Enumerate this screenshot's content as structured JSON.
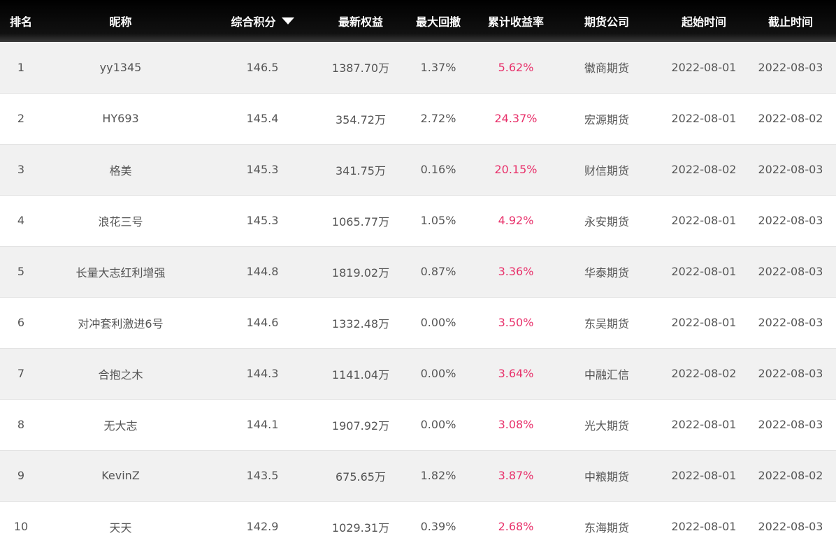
{
  "colors": {
    "header_bg": "#000000",
    "header_text": "#ffffff",
    "row_alt": "#f1f1f1",
    "text": "#555555",
    "positive_rate": "#e8306a"
  },
  "headers": {
    "rank": "排名",
    "nickname": "昵称",
    "score": "综合积分",
    "equity": "最新权益",
    "drawdown": "最大回撤",
    "return_rate": "累计收益率",
    "broker": "期货公司",
    "start": "起始时间",
    "end": "截止时间"
  },
  "sort": {
    "column": "score",
    "direction": "descending",
    "icon": "sort-down-icon"
  },
  "rows": [
    {
      "rank": "1",
      "nickname": "yy1345",
      "score": "146.5",
      "equity": "1387.70万",
      "drawdown": "1.37%",
      "return_rate": "5.62%",
      "broker": "徽商期货",
      "start": "2022-08-01",
      "end": "2022-08-03"
    },
    {
      "rank": "2",
      "nickname": "HY693",
      "score": "145.4",
      "equity": "354.72万",
      "drawdown": "2.72%",
      "return_rate": "24.37%",
      "broker": "宏源期货",
      "start": "2022-08-01",
      "end": "2022-08-02"
    },
    {
      "rank": "3",
      "nickname": "格美",
      "score": "145.3",
      "equity": "341.75万",
      "drawdown": "0.16%",
      "return_rate": "20.15%",
      "broker": "财信期货",
      "start": "2022-08-02",
      "end": "2022-08-03"
    },
    {
      "rank": "4",
      "nickname": "浪花三号",
      "score": "145.3",
      "equity": "1065.77万",
      "drawdown": "1.05%",
      "return_rate": "4.92%",
      "broker": "永安期货",
      "start": "2022-08-01",
      "end": "2022-08-03"
    },
    {
      "rank": "5",
      "nickname": "长量大志红利增强",
      "score": "144.8",
      "equity": "1819.02万",
      "drawdown": "0.87%",
      "return_rate": "3.36%",
      "broker": "华泰期货",
      "start": "2022-08-01",
      "end": "2022-08-03"
    },
    {
      "rank": "6",
      "nickname": "对冲套利激进6号",
      "score": "144.6",
      "equity": "1332.48万",
      "drawdown": "0.00%",
      "return_rate": "3.50%",
      "broker": "东吴期货",
      "start": "2022-08-01",
      "end": "2022-08-03"
    },
    {
      "rank": "7",
      "nickname": "合抱之木",
      "score": "144.3",
      "equity": "1141.04万",
      "drawdown": "0.00%",
      "return_rate": "3.64%",
      "broker": "中融汇信",
      "start": "2022-08-02",
      "end": "2022-08-03"
    },
    {
      "rank": "8",
      "nickname": "无大志",
      "score": "144.1",
      "equity": "1907.92万",
      "drawdown": "0.00%",
      "return_rate": "3.08%",
      "broker": "光大期货",
      "start": "2022-08-01",
      "end": "2022-08-03"
    },
    {
      "rank": "9",
      "nickname": "KevinZ",
      "score": "143.5",
      "equity": "675.65万",
      "drawdown": "1.82%",
      "return_rate": "3.87%",
      "broker": "中粮期货",
      "start": "2022-08-01",
      "end": "2022-08-02"
    },
    {
      "rank": "10",
      "nickname": "天天",
      "score": "142.9",
      "equity": "1029.31万",
      "drawdown": "0.39%",
      "return_rate": "2.68%",
      "broker": "东海期货",
      "start": "2022-08-01",
      "end": "2022-08-03"
    }
  ]
}
